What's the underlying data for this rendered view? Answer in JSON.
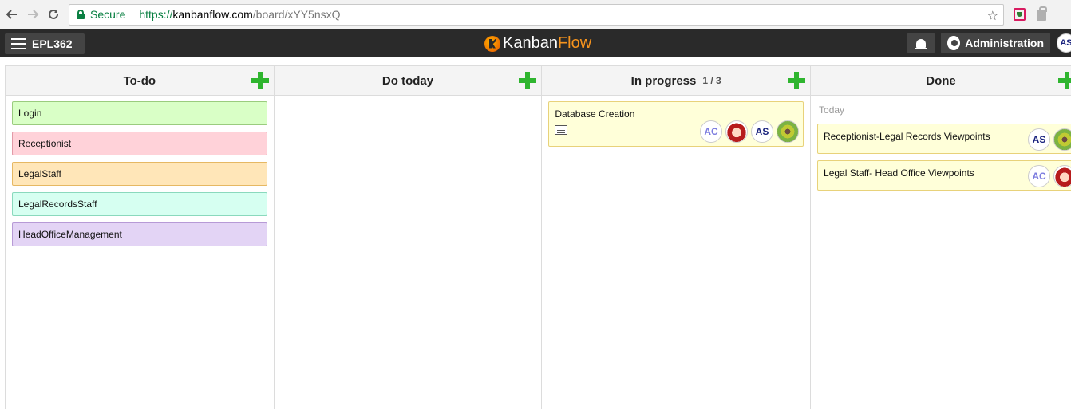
{
  "browser": {
    "secure_label": "Secure",
    "url_scheme": "https://",
    "url_host": "kanbanflow.com",
    "url_path": "/board/xYY5nsxQ"
  },
  "header": {
    "board_name": "EPL362",
    "logo_kanban": "Kanban",
    "logo_flow": "Flow",
    "admin_label": "Administration",
    "user_initials": "AS"
  },
  "columns": [
    {
      "title": "To-do",
      "tasks": [
        "Login",
        "Receptionist",
        "LegalStaff",
        "LegalRecordsStaff",
        "HeadOfficeManagement"
      ]
    },
    {
      "title": "Do today"
    },
    {
      "title": "In progress",
      "wip": "1 / 3",
      "task": {
        "title": "Database Creation",
        "avatars": [
          "AC",
          "AS"
        ]
      }
    },
    {
      "title": "Done",
      "section_label": "Today",
      "tasks": [
        {
          "title": "Receptionist-Legal Records Viewpoints",
          "avatar": "AS"
        },
        {
          "title": "Legal Staff- Head Office Viewpoints",
          "avatar": "AC"
        }
      ]
    }
  ],
  "colors": {
    "add_green": "#2fb52f",
    "logo_orange": "#f7941d",
    "header_bg": "#2a2a2a"
  }
}
